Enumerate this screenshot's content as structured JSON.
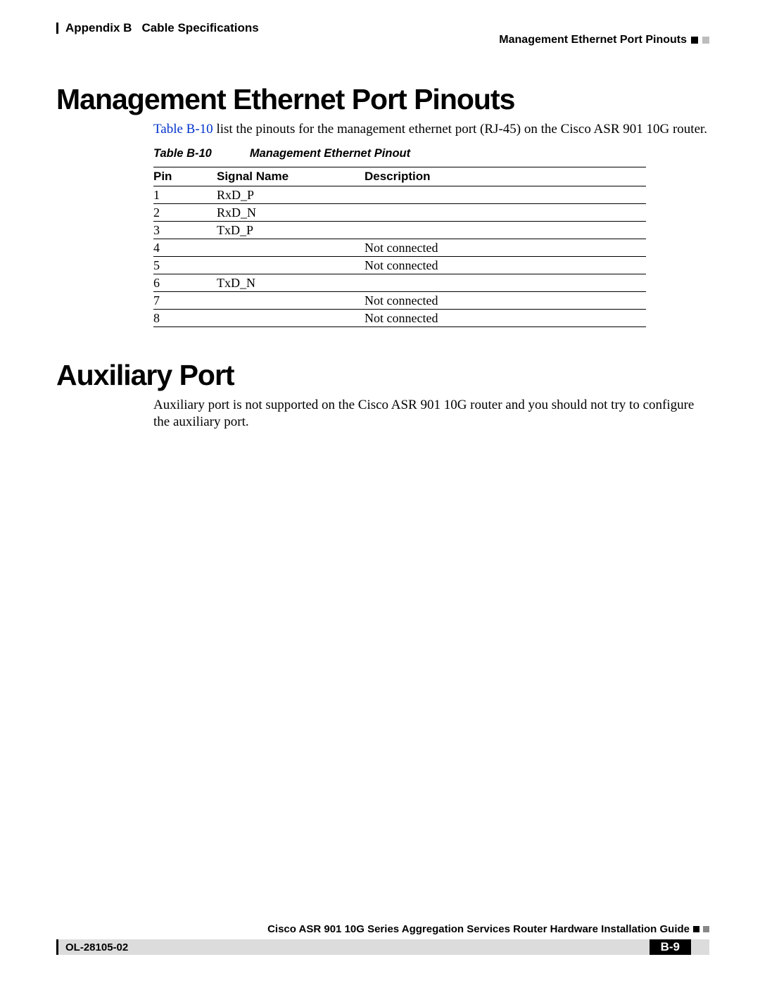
{
  "header": {
    "appendix": "Appendix B",
    "chapter": "Cable Specifications",
    "section": "Management Ethernet Port Pinouts"
  },
  "sections": {
    "mgmt": {
      "title": "Management Ethernet Port Pinouts",
      "link_text": "Table B-10",
      "para_rest": " list the pinouts for the management ethernet port (RJ-45) on the Cisco ASR 901 10G router."
    },
    "aux": {
      "title": "Auxiliary Port",
      "para": "Auxiliary port is not supported on the Cisco ASR 901 10G router and you should not try to configure the auxiliary port."
    }
  },
  "table": {
    "number": "Table B-10",
    "caption": "Management Ethernet Pinout",
    "headers": {
      "c1": "Pin",
      "c2": "Signal Name",
      "c3": "Description"
    },
    "rows": [
      {
        "pin": "1",
        "signal": "RxD_P",
        "desc": ""
      },
      {
        "pin": "2",
        "signal": "RxD_N",
        "desc": ""
      },
      {
        "pin": "3",
        "signal": "TxD_P",
        "desc": ""
      },
      {
        "pin": "4",
        "signal": "",
        "desc": "Not connected"
      },
      {
        "pin": "5",
        "signal": "",
        "desc": "Not connected"
      },
      {
        "pin": "6",
        "signal": "TxD_N",
        "desc": ""
      },
      {
        "pin": "7",
        "signal": "",
        "desc": "Not connected"
      },
      {
        "pin": "8",
        "signal": "",
        "desc": "Not connected"
      }
    ]
  },
  "footer": {
    "doc_title": "Cisco ASR 901 10G Series Aggregation Services Router Hardware Installation Guide",
    "doc_id": "OL-28105-02",
    "page": "B-9"
  }
}
